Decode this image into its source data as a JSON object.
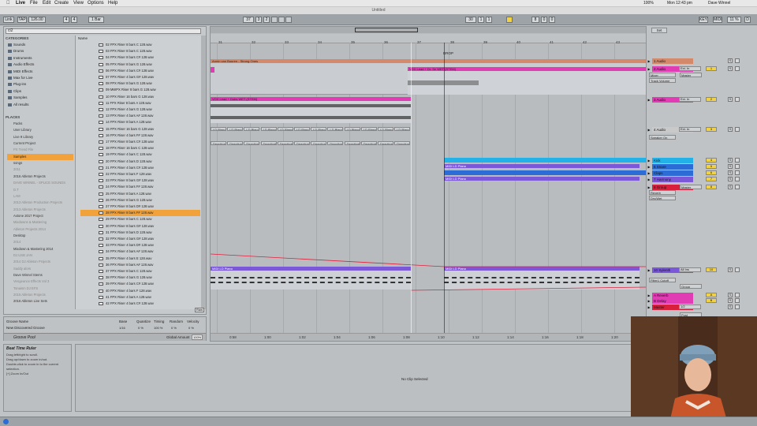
{
  "menubar": {
    "apple": "",
    "items": [
      "Live",
      "File",
      "Edit",
      "Create",
      "View",
      "Options",
      "Help"
    ],
    "battery": "100%",
    "clock": "Mon 12:43 pm",
    "user": "Dave Winnel"
  },
  "window_title": "Untitled",
  "transport": {
    "link": "Link",
    "tap": "TAP",
    "tempo": "126.00",
    "time_sig_num": "4",
    "time_sig_den": "4",
    "quantize": "1 Bar",
    "position": "37",
    "pos_beat": "3",
    "pos_six": "2",
    "loop_start": "30",
    "loop_beat": "1",
    "loop_six": "1",
    "loop_len": "8",
    "loop_len_b": "0",
    "loop_len_c": "0",
    "key": "KEY",
    "midi": "MIDI",
    "cpu": "11 %",
    "d_label": "D"
  },
  "colors": {
    "accent": "#f2a23a",
    "pink": "#e23cb4",
    "salmon": "#d48a6a",
    "blue": "#2b6cd6",
    "cyan": "#23b2e8",
    "purple": "#7a58d8",
    "red": "#d8203c",
    "yellow": "#f2d245"
  },
  "browser": {
    "search_value": "cl2",
    "categories_label": "CATEGORIES",
    "categories": [
      "Sounds",
      "Drums",
      "Instruments",
      "Audio Effects",
      "MIDI Effects",
      "Max for Live",
      "Plug-ins",
      "Clips",
      "Samples",
      "All results"
    ],
    "places_label": "PLACES",
    "places": [
      {
        "name": "Packs",
        "state": ""
      },
      {
        "name": "User Library",
        "state": ""
      },
      {
        "name": "Live 9 Library",
        "state": ""
      },
      {
        "name": "Current Project",
        "state": ""
      },
      {
        "name": "PX Trend File",
        "state": "dim"
      },
      {
        "name": "Samples",
        "state": "sel"
      },
      {
        "name": "songs",
        "state": ""
      },
      {
        "name": "2011",
        "state": "dim"
      },
      {
        "name": "2016 Ableton Projects",
        "state": ""
      },
      {
        "name": "DAVE WINNEL - SPLICE SOUNDS",
        "state": "dim"
      },
      {
        "name": "D.T",
        "state": "dim"
      },
      {
        "name": "LAM",
        "state": "dim"
      },
      {
        "name": "2013 Ableton Production Projects",
        "state": "dim"
      },
      {
        "name": "2013 Ableton Projects",
        "state": "dim"
      },
      {
        "name": "Axtone 2017 Project",
        "state": ""
      },
      {
        "name": "Mixdowns & Mastering",
        "state": "dim"
      },
      {
        "name": "Ableton Projects 2014",
        "state": "dim"
      },
      {
        "name": "Desktop",
        "state": ""
      },
      {
        "name": "2014",
        "state": "dim"
      },
      {
        "name": "Mixdown & Mastering 2014",
        "state": ""
      },
      {
        "name": "DJ USB JAN",
        "state": "dim"
      },
      {
        "name": "2014 DJ Ableton Projects",
        "state": "dim"
      },
      {
        "name": "Saddy alors",
        "state": "dim"
      },
      {
        "name": "Dave Winnel Stems",
        "state": ""
      },
      {
        "name": "Vengeance Effects Vol 3",
        "state": "dim"
      },
      {
        "name": "Tonaism DJ EFS",
        "state": "dim"
      },
      {
        "name": "2015 Ableton Projects",
        "state": "dim"
      },
      {
        "name": "2016 Ableton Live Sets",
        "state": ""
      }
    ],
    "name_header": "Name",
    "files": [
      "02 FPX Riser 8 bars C 128.wav",
      "03 FPX Riser 8 bars C 128.wav",
      "04 FPX Riser 8 bars C# 128.wav",
      "05 FPX Riser 8 bars G 128.wav",
      "06 FPX Riser 4 bars C# 128.wav",
      "07 FPX Riser 4 bars G# 128.wav",
      "08 FPX Riser 8 bars G 128.wav",
      "09 MWPX Riser 8 bars G 128.wav",
      "10 FPX Riser 16 bars G 128.wav",
      "11 FPX Riser 8 bars A 128.wav",
      "12 FPX Riser 4 bars G 128.wav",
      "13 FPX Riser 4 bars A# 128.wav",
      "14 FPX Riser 8 bars A 128.wav",
      "15 FPX Riser 16 bars G 128.wav",
      "16 FPX Riser 4 bars F# 128.wav",
      "17 FPX Riser 8 bars C# 128.wav",
      "18 FPX Riser 16 bars C 128.wav",
      "19 FPX Riser 4 bars C 128.wav",
      "20 FPX Riser 4 bars D 128.wav",
      "21 FPX Riser 4 bars C# 128.wav",
      "22 FPX Riser 8 bars F 128.wav",
      "23 FPX Riser 8 bars G# 128.wav",
      "24 FPX Riser 8 bars F# 128.wav",
      "25 FPX Riser 8 bars A 128.wav",
      "26 FPX Riser 8 bars G 128.wav",
      "27 FPX Riser 8 bars D# 128.wav",
      "28 FPX Riser 8 bars F# 128.wav",
      "29 FPX Riser 8 bars C 128.wav",
      "30 FPX Riser 8 bars G# 128.wav",
      "31 FPX Riser 8 bars D 128.wav",
      "32 FPX Riser 4 bars G# 128.wav",
      "33 FPX Riser 4 bars D# 128.wav",
      "34 FPX Riser 4 bars A# 128.wav",
      "35 FPX Riser 4 bars E 128.wav",
      "36 FPX Riser 8 bars A# 128.wav",
      "37 FPX Riser 8 bars C 128.wav",
      "38 FPX Riser 4 bars G 128.wav",
      "39 FPX Riser 4 bars C# 128.wav",
      "40 FPX Riser 4 bars F 128.wav",
      "41 FPX Riser 4 bars A 128.wav",
      "42 FPX Riser 4 bars C# 128.wav"
    ],
    "selected_file_index": 26,
    "raw_label": "Raw"
  },
  "groove": {
    "col_name": "Groove Name",
    "col_base": "Base",
    "col_quantize": "Quantize",
    "col_timing": "Timing",
    "col_random": "Random",
    "col_velocity": "Velocity",
    "row_name": "New Discovered Groove",
    "base_val": "1/16",
    "q_val": "0 %",
    "t_val": "100 %",
    "r_val": "0 %",
    "v_val": "0 %",
    "pool_label": "Groove Pool",
    "global_label": "Global Amount",
    "global_val": "100%"
  },
  "info": {
    "title": "Beat Time Ruler",
    "lines": [
      "Drag left/right to scroll.",
      "Drag up/down to zoom in/out.",
      "Double-click to zoom in to the current",
      "selection.",
      "",
      "[+] Zoom In/Out"
    ]
  },
  "clip_view": {
    "empty_text": "No Clip Selected"
  },
  "arrangement": {
    "bars": [
      "31",
      "32",
      "33",
      "34",
      "35",
      "36",
      "37",
      "38",
      "39",
      "40",
      "41",
      "42",
      "43"
    ],
    "locator": "DROP",
    "time_ticks": [
      "0:58",
      "1:00",
      "1:02",
      "1:04",
      "1:06",
      "1:08",
      "1:10",
      "1:12",
      "1:14",
      "1:16",
      "1:18",
      "1:20",
      "1:22"
    ],
    "clip_labels": {
      "strong_ones": "Armin van Buuren - Strong Ones",
      "vox_lead": "VOX Lead + Dr. Se WET (STEM)",
      "vox_lead2": "VOX Lead + Dubs WET (STEM)",
      "ld_piano": "LD Piano",
      "deactivated": "Deactivat",
      "midi_piano": "MIDI LD Piano",
      "midi_piano_b": "MIDI LD Piano",
      "midi_piano_c": "MIDI LD Piano",
      "midi_piano_d": "MIDI LD Piano"
    }
  },
  "mixer": {
    "set_label": "Set",
    "tracks": [
      {
        "name": "1 Audio",
        "color": "#d48a6a",
        "io": "",
        "num": "",
        "s": "S"
      },
      {
        "name": "2 Audio",
        "color": "#e23cb4",
        "io": "Ext. In",
        "num": "1",
        "s": "S"
      },
      {
        "name": "3 Audio",
        "color": "#e23cb4",
        "io": "Ext. In",
        "num": "2",
        "s": "S"
      },
      {
        "name": "4 Audio",
        "color": "#c9c9c9",
        "io": "Ext. In",
        "num": "3",
        "s": "S"
      },
      {
        "name": "Kick",
        "color": "#23b2e8",
        "io": "",
        "num": "4",
        "s": "S"
      },
      {
        "name": "6 Snare",
        "color": "#2b6cd6",
        "io": "",
        "num": "5",
        "s": "S"
      },
      {
        "name": "Claps",
        "color": "#2b6cd6",
        "io": "",
        "num": "6",
        "s": "S"
      },
      {
        "name": "7 Harmony",
        "color": "#7a58d8",
        "io": "",
        "num": "7",
        "s": "S"
      },
      {
        "name": "8 Group",
        "color": "#d8203c",
        "io": "",
        "num": "8",
        "s": "S"
      },
      {
        "name": "10 Sylenth",
        "color": "#7a58d8",
        "io": "All Ins",
        "num": "10",
        "s": "S"
      },
      {
        "name": "A Reverb",
        "color": "#e23cb4",
        "io": "",
        "num": "A",
        "s": "S"
      },
      {
        "name": "B Delay",
        "color": "#e23cb4",
        "io": "",
        "num": "B",
        "s": "S"
      },
      {
        "name": "Master",
        "color": "#d8203c",
        "io": "1/2",
        "num": "",
        "s": "S"
      }
    ],
    "sub_labels": {
      "mixer": "Mixer",
      "track_volume": "Track Volume",
      "master": "Master",
      "speaker_on": "Speaker On",
      "reverb": "Reverb",
      "dry_wet": "Dry/Wet",
      "filter_cutoff": "Filter1 Cutoff",
      "group": "Group",
      "post": "Post"
    }
  },
  "status": {
    "left": "",
    "right": ""
  }
}
